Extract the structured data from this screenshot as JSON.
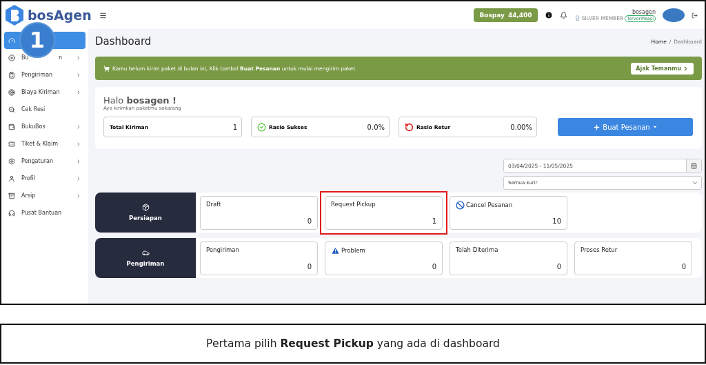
{
  "logo": {
    "name": "bosAgen"
  },
  "header": {
    "balance_label": "Bospay",
    "balance": "44,400",
    "username": "bosagen",
    "member_level": "SILVER MEMBER",
    "verified_badge": "Terverifikasi"
  },
  "step_marker": {
    "number": "1"
  },
  "sidebar": {
    "items": [
      {
        "selected": true,
        "expandable": false
      },
      {
        "label": "Bu",
        "label_tail": "n",
        "selected": false,
        "expandable": true
      },
      {
        "label": "Pengiriman",
        "selected": false,
        "expandable": true
      },
      {
        "label": "Biaya Kiriman",
        "selected": false,
        "expandable": true
      },
      {
        "label": "Cek Resi",
        "selected": false,
        "expandable": false
      },
      {
        "label": "BukuBos",
        "selected": false,
        "expandable": true
      },
      {
        "label": "Tiket & Klaim",
        "selected": false,
        "expandable": true
      },
      {
        "label": "Pengaturan",
        "selected": false,
        "expandable": true
      },
      {
        "label": "Profil",
        "selected": false,
        "expandable": true
      },
      {
        "label": "Arsip",
        "selected": false,
        "expandable": true
      },
      {
        "label": "Pusat Bantuan",
        "selected": false,
        "expandable": false
      }
    ]
  },
  "page_title": "Dashboard",
  "breadcrumb": {
    "items": [
      "Home",
      "Dashboard"
    ],
    "separator": "/"
  },
  "banner": {
    "message": "Kamu belum kirim paket di bulan ini, Klik tombol **Buat Pesanan** untuk mulai mengirim paket",
    "button": "Ajak Temanmu"
  },
  "greeting": {
    "prefix": "Halo",
    "name": "bosagen !",
    "subtitle": "Ayo kirimkan paketmu sekarang"
  },
  "stats": [
    {
      "label": "Total Kiriman",
      "value": "1"
    },
    {
      "label": "Rasio Sukses",
      "value": "0.0%"
    },
    {
      "label": "Rasio Retur",
      "value": "0.00%"
    }
  ],
  "create_button": "Buat Pesanan",
  "filters": {
    "date_range": "03/04/2025 - 11/05/2025",
    "courier": "Semua kurir"
  },
  "sections": [
    {
      "title": "Persiapan",
      "cards": [
        {
          "label": "Draft",
          "value": "0",
          "highlighted": false
        },
        {
          "label": "Request Pickup",
          "value": "1",
          "highlighted": true
        },
        {
          "label": "Cancel Pesanan",
          "value": "10",
          "highlighted": false
        }
      ]
    },
    {
      "title": "Pengiriman",
      "cards": [
        {
          "label": "Pengiriman",
          "value": "0",
          "highlighted": false
        },
        {
          "label": "Problem",
          "value": "0",
          "highlighted": false
        },
        {
          "label": "Telah Diterima",
          "value": "0",
          "highlighted": false
        },
        {
          "label": "Proses Retur",
          "value": "0",
          "highlighted": false
        }
      ]
    }
  ],
  "caption": "Pertama pilih **Request Pickup** yang ada di dashboard"
}
